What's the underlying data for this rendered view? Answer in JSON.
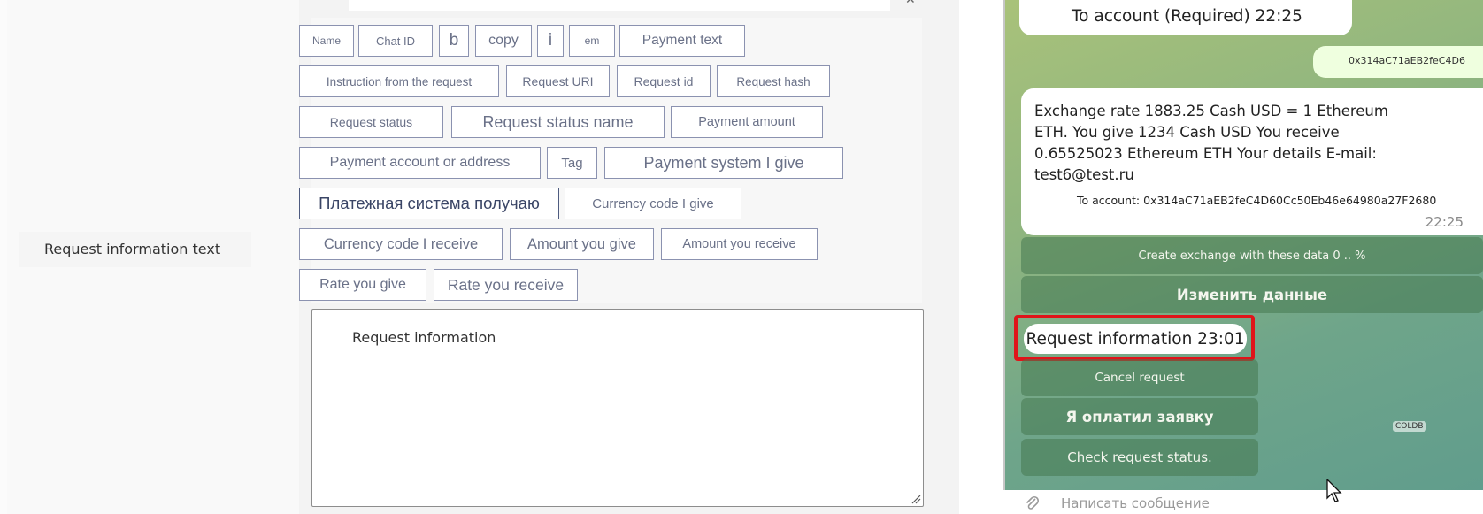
{
  "form": {
    "field_label": "Request information text",
    "editor_text": "Request information",
    "tags": [
      "Name",
      "Chat ID",
      "b",
      "copy",
      "i",
      "em",
      "Payment text",
      "Instruction from the request",
      "Request URI",
      "Request id",
      "Request hash",
      "Request status",
      "Request status name",
      "Payment amount",
      "Payment account or address",
      "Tag",
      "Payment system I give",
      "Платежная система получаю",
      "Currency code I give",
      "Currency code I receive",
      "Amount you give",
      "Amount you receive",
      "Rate you give",
      "Rate you receive"
    ]
  },
  "telegram": {
    "msg_top": "To account (Required) 22:25",
    "msg_address": "0x314aC71aEB2feC4D6",
    "msg_main": "Exchange rate 1883.25 Cash USD = 1 Ethereum ETH. You give 1234 Cash USD You receive 0.65525023 Ethereum ETH Your details E-mail: test6@test.ru",
    "msg_account": "To account: 0x314aC71aEB2feC4D60Cc50Eb46e64980a27F2680",
    "msg_time": "22:25",
    "keyboard": {
      "create": "Create exchange with these data 0 .. %",
      "edit": "Изменить данные",
      "cancel": "Cancel request",
      "paid": "Я оплатил заявку",
      "check": "Check request status."
    },
    "highlighted_msg": "Request information 23:01",
    "badge": "COLDB",
    "input_placeholder": "Написать сообщение",
    "colors": {
      "highlight": "#e0141a",
      "bubble": "#ffffff",
      "outgoing": "#efffdf"
    }
  }
}
